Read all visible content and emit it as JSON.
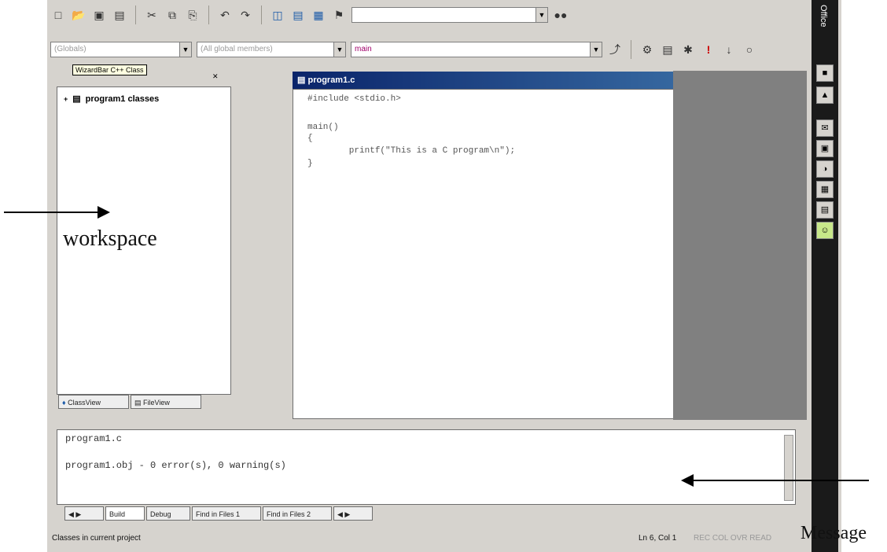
{
  "toolbar": {
    "wizard_tooltip": "WizardBar C++ Class",
    "combo_class": "(Globals)",
    "combo_members": "(All global members)",
    "combo_function": "main"
  },
  "workspace": {
    "tree_root": "program1 classes",
    "tab_classview": "ClassView",
    "tab_fileview": "FileView"
  },
  "editor": {
    "title": "program1.c",
    "code": [
      "#include <stdio.h>",
      "",
      "main()",
      "{",
      "        printf(\"This is a C program\\n\");",
      "}"
    ]
  },
  "output": {
    "line1": "program1.c",
    "line2": "program1.obj - 0 error(s), 0 warning(s)",
    "tabs": [
      "Build",
      "Debug",
      "Find in Files 1",
      "Find in Files 2"
    ]
  },
  "status": {
    "left": "Classes in current project",
    "pos": "Ln 6, Col 1",
    "indicators": "REC COL OVR READ"
  },
  "office_bar": {
    "label": "Office"
  },
  "annotations": {
    "workspace": "workspace",
    "message": "Message"
  }
}
